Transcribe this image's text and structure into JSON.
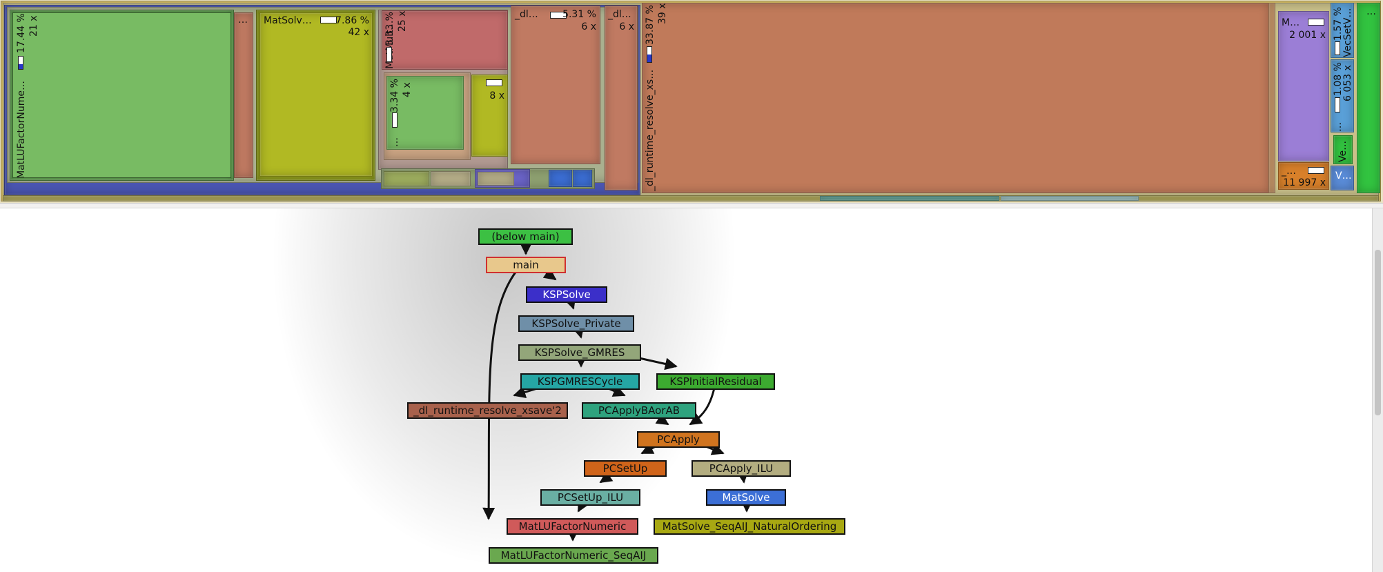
{
  "treemap": {
    "blocks": {
      "matlu": {
        "label": "MatLUFactorNume…",
        "percent": "17.44 %",
        "calls": "21 x",
        "color": "#78bb63"
      },
      "small_dots": {
        "label": "…",
        "color": "#c07a62"
      },
      "matsolve": {
        "label": "MatSolv…",
        "percent": "7.86 %",
        "calls": "42 x",
        "color": "#b1b923"
      },
      "matmult": {
        "label": "MatMult…",
        "percent": "3.33 %",
        "calls": "25 x",
        "color": "#c06a6a"
      },
      "ilu_inner": {
        "label": "…",
        "percent": "3.34 %",
        "calls": "4 x",
        "color": "#78bb63"
      },
      "small_yellow": {
        "calls": "8 x",
        "color": "#b1b923"
      },
      "dl1": {
        "label": "_dl…",
        "percent": "5.31 %",
        "calls": "6 x",
        "color": "#c07a62"
      },
      "dl2": {
        "label": "_dl…",
        "calls": "6 x",
        "color": "#c07a62"
      },
      "dl_big": {
        "label": "_dl_runtime_resolve_xs…",
        "percent": "33.87 %",
        "calls": "39 x",
        "color": "#c07a5a"
      },
      "purple": {
        "label": "M…",
        "calls": "2 001 x",
        "color": "#9b7ed6"
      },
      "orange_small": {
        "label": "_…",
        "calls": "11 997 x",
        "color": "#d8802a"
      },
      "vec_top": {
        "label": "VecSetV…",
        "percent": "1.57 %",
        "color": "#5aa0d8"
      },
      "vec_mid": {
        "label": "…",
        "percent": "1.08 %",
        "calls": "6 053 x",
        "color": "#5aa0d8"
      },
      "vec_green": {
        "label": "Ve…",
        "color": "#32c440"
      },
      "vec_bottom": {
        "label": "V…",
        "color": "#5a8cd8"
      },
      "far_right": {
        "label": "…",
        "color": "#32c440"
      }
    }
  },
  "callgraph": {
    "nodes": {
      "below_main": {
        "label": "(below main)",
        "color": "#3cc043"
      },
      "main": {
        "label": "main",
        "color": "#e8c88c"
      },
      "kspsolve": {
        "label": "KSPSolve",
        "color": "#3b2fc9"
      },
      "kspsolve_private": {
        "label": "KSPSolve_Private",
        "color": "#6f8fa8"
      },
      "kspsolve_gmres": {
        "label": "KSPSolve_GMRES",
        "color": "#93a67a"
      },
      "kspgmrescycle": {
        "label": "KSPGMRESCycle",
        "color": "#25a6a4"
      },
      "kspinitialresidual": {
        "label": "KSPInitialResidual",
        "color": "#3caa30"
      },
      "dl_resolve": {
        "label": "_dl_runtime_resolve_xsave'2",
        "color": "#a8614c"
      },
      "pcapplybaorab": {
        "label": "PCApplyBAorAB",
        "color": "#2ea37e"
      },
      "pcapply": {
        "label": "PCApply",
        "color": "#d0741f"
      },
      "pcsetup": {
        "label": "PCSetUp",
        "color": "#d0641a"
      },
      "pcapply_ilu": {
        "label": "PCApply_ILU",
        "color": "#b3ad80"
      },
      "pcsetup_ilu": {
        "label": "PCSetUp_ILU",
        "color": "#6aafa3"
      },
      "matsolve": {
        "label": "MatSolve",
        "color": "#3c6fd6"
      },
      "matlufactornumeric": {
        "label": "MatLUFactorNumeric",
        "color": "#d05a5a"
      },
      "matsolve_seqaij": {
        "label": "MatSolve_SeqAIJ_NaturalOrdering",
        "color": "#a8a812"
      },
      "matlufactornumeric_seqaij": {
        "label": "MatLUFactorNumeric_SeqAIJ",
        "color": "#6aa84f"
      }
    }
  }
}
